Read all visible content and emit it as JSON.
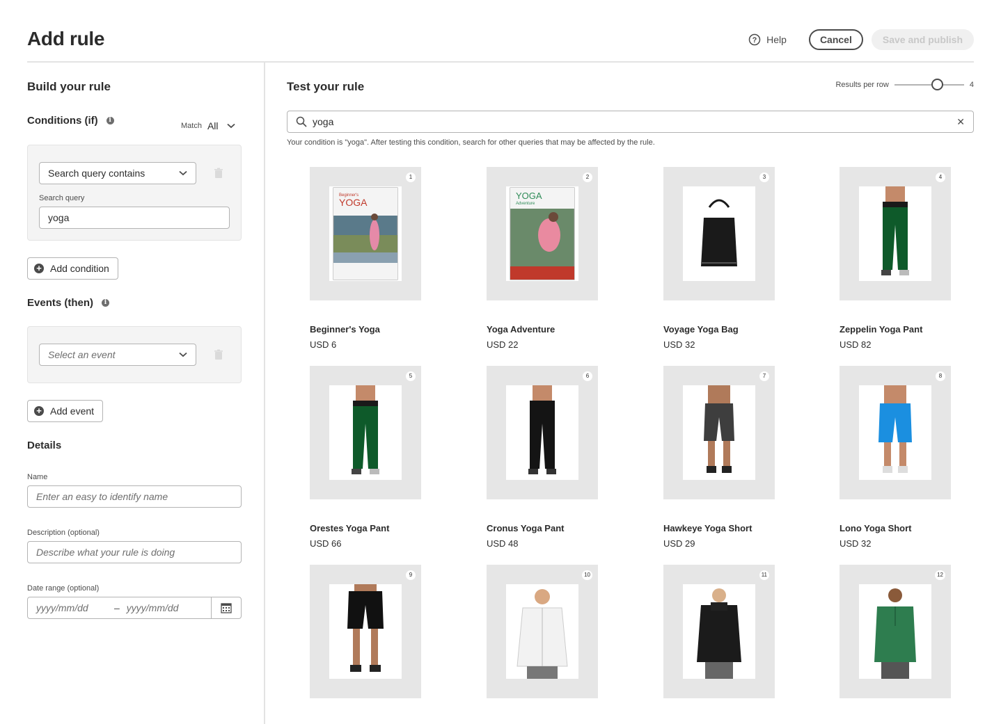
{
  "header": {
    "title": "Add rule",
    "help_label": "Help",
    "cancel_label": "Cancel",
    "publish_label": "Save and publish"
  },
  "build": {
    "heading": "Build your rule",
    "conditions_heading": "Conditions (if)",
    "match_label": "Match",
    "match_value": "All",
    "condition_type": "Search query contains",
    "search_query_label": "Search query",
    "search_query_value": "yoga",
    "add_condition_label": "Add condition",
    "events_heading": "Events (then)",
    "event_placeholder": "Select an event",
    "add_event_label": "Add event",
    "details_heading": "Details",
    "name_label": "Name",
    "name_placeholder": "Enter an easy to identify name",
    "description_label": "Description (optional)",
    "description_placeholder": "Describe what your rule is doing",
    "date_range_label": "Date range (optional)",
    "date_start_placeholder": "yyyy/mm/dd",
    "date_separator": "–",
    "date_end_placeholder": "yyyy/mm/dd"
  },
  "test": {
    "heading": "Test your rule",
    "results_per_row_label": "Results per row",
    "results_per_row_value": "4",
    "search_value": "yoga",
    "hint": "Your condition is \"yoga\". After testing this condition, search for other queries that may be affected by the rule."
  },
  "products": [
    {
      "rank": "1",
      "name": "Beginner's Yoga",
      "price": "USD 6",
      "kind": "dvd-beginner"
    },
    {
      "rank": "2",
      "name": "Yoga Adventure",
      "price": "USD 22",
      "kind": "dvd-adventure"
    },
    {
      "rank": "3",
      "name": "Voyage Yoga Bag",
      "price": "USD 32",
      "kind": "bag"
    },
    {
      "rank": "4",
      "name": "Zeppelin Yoga Pant",
      "price": "USD 82",
      "kind": "pant-green"
    },
    {
      "rank": "5",
      "name": "Orestes Yoga Pant",
      "price": "USD 66",
      "kind": "pant-green"
    },
    {
      "rank": "6",
      "name": "Cronus Yoga Pant",
      "price": "USD 48",
      "kind": "pant-black"
    },
    {
      "rank": "7",
      "name": "Hawkeye Yoga Short",
      "price": "USD 29",
      "kind": "short-grey"
    },
    {
      "rank": "8",
      "name": "Lono Yoga Short",
      "price": "USD 32",
      "kind": "short-blue"
    },
    {
      "rank": "9",
      "name": "",
      "price": "",
      "kind": "short-black"
    },
    {
      "rank": "10",
      "name": "",
      "price": "",
      "kind": "hoodie-white"
    },
    {
      "rank": "11",
      "name": "",
      "price": "",
      "kind": "jacket-black"
    },
    {
      "rank": "12",
      "name": "",
      "price": "",
      "kind": "top-green"
    }
  ],
  "icons": {
    "help": "help-circle-icon",
    "chevron": "chevron-down-icon",
    "trash": "trash-icon",
    "info": "info-icon",
    "plus": "add-circle-icon",
    "search": "search-icon",
    "clear": "close-icon",
    "calendar": "calendar-icon"
  },
  "colors": {
    "text": "#2c2c2c",
    "muted": "#6e6e6e",
    "border": "#b3b3b3",
    "tile": "#e6e6e6",
    "panel": "#f4f4f4",
    "disabled_text": "#c8c8c8"
  }
}
